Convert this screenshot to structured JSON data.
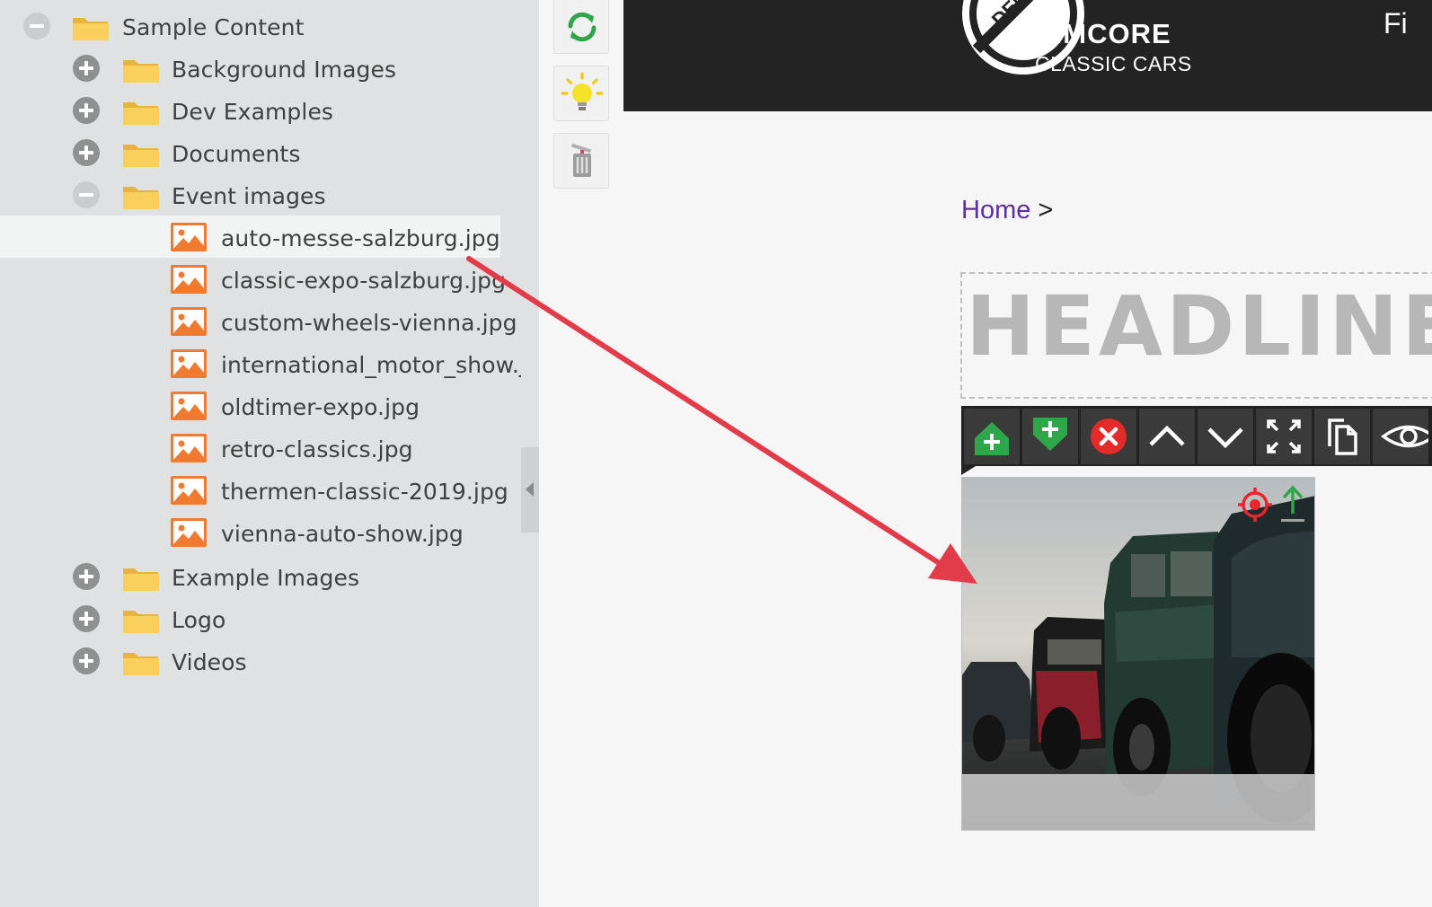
{
  "tree": {
    "root": {
      "label": "Sample Content"
    },
    "folders_top": [
      {
        "label": "Background Images"
      },
      {
        "label": "Dev Examples"
      },
      {
        "label": "Documents"
      }
    ],
    "open_folder": {
      "label": "Event images",
      "files": [
        {
          "label": "auto-messe-salzburg.jpg"
        },
        {
          "label": "classic-expo-salzburg.jpg"
        },
        {
          "label": "custom-wheels-vienna.jpg"
        },
        {
          "label": "international_motor_show.jp"
        },
        {
          "label": "oldtimer-expo.jpg"
        },
        {
          "label": "retro-classics.jpg"
        },
        {
          "label": "thermen-classic-2019.jpg"
        },
        {
          "label": "vienna-auto-show.jpg"
        }
      ]
    },
    "folders_bottom": [
      {
        "label": "Example Images"
      },
      {
        "label": "Logo"
      },
      {
        "label": "Videos"
      }
    ],
    "selected_file_index": 0
  },
  "tools": [
    {
      "icon": "refresh-icon"
    },
    {
      "icon": "lightbulb-icon"
    },
    {
      "icon": "trash-icon"
    }
  ],
  "site_header": {
    "seal_text": "DEMO",
    "brand": "PIMCORE",
    "tagline": "CLASSIC CARS",
    "nav_partial": "Fi"
  },
  "breadcrumb": {
    "home": "Home",
    "separator": ">"
  },
  "headline": {
    "placeholder": "HEADLINE"
  },
  "area_toolbar": {
    "buttons": [
      "add-block-before-icon",
      "add-block-after-icon",
      "remove-block-icon",
      "move-up-icon",
      "move-down-icon",
      "fullscreen-icon",
      "copy-icon",
      "preview-eye-icon"
    ]
  },
  "colors": {
    "sidebar_bg": "#e0e1e2",
    "header_bg": "#232323",
    "link_purple": "#5d2ea3",
    "arrow_red": "#e23c4a",
    "image_icon_orange": "#f07a30",
    "folder_yellow": "#f9cf5e"
  }
}
